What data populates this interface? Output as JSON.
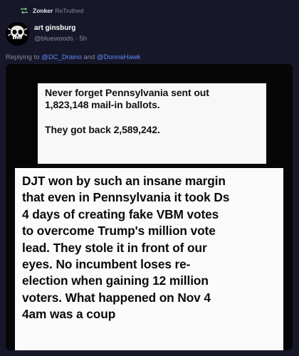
{
  "retruth": {
    "icon": "retruth-icon",
    "user": "Zonker",
    "label": "ReTruthed"
  },
  "author": {
    "avatar_icon": "skull-avatar-icon",
    "display_name": "art ginsburg",
    "meta": "@bluewoods · 5h"
  },
  "reply": {
    "prefix": "Replying to ",
    "mention1": "@DC_Draino",
    "joiner": " and ",
    "mention2": "@DonnaHawk"
  },
  "media": {
    "card1": {
      "line1": "Never forget Pennsylvania sent out",
      "line2": "1,823,148 mail-in ballots.",
      "line3": "They got back 2,589,242."
    },
    "card2": {
      "text": "DJT won by such an insane margin\nthat even in Pennsylvania it took Ds\n4 days of creating fake VBM votes\nto overcome Trump's million vote\nlead. They stole it in front of our\neyes. No incumbent loses re-\nelection when gaining 12 million\nvoters. What happened on Nov 4\n4am was a coup"
    }
  },
  "colors": {
    "background": "#17172a",
    "mention": "#5b8cf7",
    "muted": "#8a8aa0"
  }
}
